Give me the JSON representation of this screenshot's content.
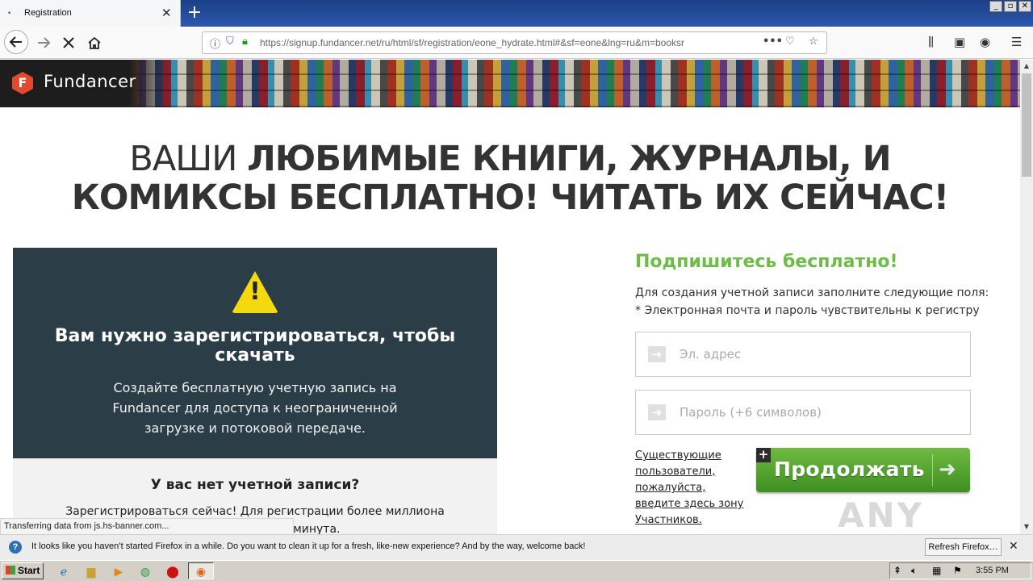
{
  "browser": {
    "tab_title": "Registration",
    "tab_dot": "•",
    "tab_close": "✕",
    "new_tab": "+",
    "window_buttons": [
      "_",
      "▫",
      "✕"
    ],
    "url": "https://signup.fundancer.net/ru/html/sf/registration/eone_hydrate.html#&sf=eone&lng=ru&m=booksr",
    "more_actions": "•••",
    "status_text": "Transferring data from js.hs-banner.com..."
  },
  "site": {
    "logo_letter": "F",
    "logo_text": "Fundancer",
    "headline": {
      "line1_thin": "ВАШИ ",
      "line1_bold": "ЛЮБИМЫЕ КНИГИ, ЖУРНАЛЫ, И",
      "line2_bold": "КОМИКСЫ БЕСПЛАТНО! ЧИТАТЬ ИХ СЕЙЧАС!"
    },
    "warning_panel": {
      "icon_glyph": "!",
      "title": "Вам нужно зарегистрироваться, чтобы скачать",
      "text": "Создайте бесплатную учетную запись на Fundancer для доступа к неограниченной загрузке и потоковой передаче."
    },
    "no_account": {
      "title": "У вас нет учетной записи?",
      "text": "Зарегистрироваться сейчас! Для регистрации более миллиона титров нужна всего минута."
    },
    "signup": {
      "title": "Подпишитесь бесплатно!",
      "desc_line1": "Для создания учетной записи заполните следующие поля:",
      "desc_line2": "* Электронная почта и пароль чувствительны к регистру",
      "email_placeholder": "Эл. адрес",
      "password_placeholder": "Пароль (+6 символов)",
      "members_link": "Существующие пользователи, пожалуйста, введите здесь зону Участников.",
      "continue_label": "Продолжать",
      "continue_plus": "+",
      "continue_arrow": "➜",
      "field_arrow": "➜"
    },
    "watermark": "ANY RUN"
  },
  "notification": {
    "message": "It looks like you haven’t started Firefox in a while. Do you want to clean it up for a fresh, like-new experience? And by the way, welcome back!",
    "refresh_button": "Refresh Firefox…",
    "close": "✕",
    "icon": "?"
  },
  "taskbar": {
    "start_label": "Start",
    "clock": "3:55 PM"
  },
  "colors": {
    "accent_green": "#6cbd45",
    "panel_dark": "#2b3d47",
    "warning_yellow": "#f5d90f",
    "logo_red": "#e2492f"
  }
}
